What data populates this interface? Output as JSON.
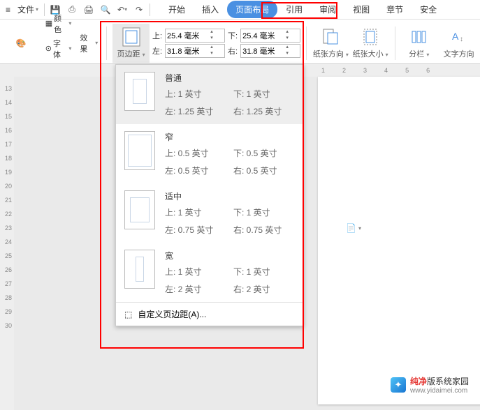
{
  "menubar": {
    "file": "文件",
    "tabs": [
      "开始",
      "插入",
      "页面布局",
      "引用",
      "审阅",
      "视图",
      "章节",
      "安全"
    ],
    "active_tab_index": 2
  },
  "ribbon": {
    "theme_group": {
      "color_label": "颜色",
      "font_label": "字体",
      "effect_label": "效果",
      "theme_label": "主题"
    },
    "margins_button": "页边距",
    "margin_fields": {
      "top_label": "上:",
      "bottom_label": "下:",
      "left_label": "左:",
      "right_label": "右:",
      "top_val": "25.4 毫米",
      "bottom_val": "25.4 毫米",
      "left_val": "31.8 毫米",
      "right_val": "31.8 毫米"
    },
    "paper_orient": "纸张方向",
    "paper_size": "纸张大小",
    "columns": "分栏",
    "text_direction": "文字方向"
  },
  "presets": [
    {
      "name": "普通",
      "top": "上: 1 英寸",
      "bottom": "下: 1 英寸",
      "left": "左: 1.25 英寸",
      "right": "右: 1.25 英寸",
      "cls": "normal"
    },
    {
      "name": "窄",
      "top": "上: 0.5 英寸",
      "bottom": "下: 0.5 英寸",
      "left": "左: 0.5 英寸",
      "right": "右: 0.5 英寸",
      "cls": "narrow"
    },
    {
      "name": "适中",
      "top": "上: 1 英寸",
      "bottom": "下: 1 英寸",
      "left": "左: 0.75 英寸",
      "right": "右: 0.75 英寸",
      "cls": "moderate"
    },
    {
      "name": "宽",
      "top": "上: 1 英寸",
      "bottom": "下: 1 英寸",
      "left": "左: 2 英寸",
      "right": "右: 2 英寸",
      "cls": "wide"
    }
  ],
  "custom_margin_label": "自定义页边距(A)...",
  "ruler_left": [
    "13",
    "14",
    "15",
    "16",
    "17",
    "18",
    "19",
    "20",
    "21",
    "22",
    "23",
    "24",
    "25",
    "26",
    "27",
    "28",
    "29",
    "30"
  ],
  "ruler_top": [
    "1",
    "2",
    "3",
    "4",
    "5",
    "6"
  ],
  "watermark": {
    "brand_bold": "纯净",
    "brand_rest": "版系统家园",
    "url": "www.yidaimei.com"
  }
}
